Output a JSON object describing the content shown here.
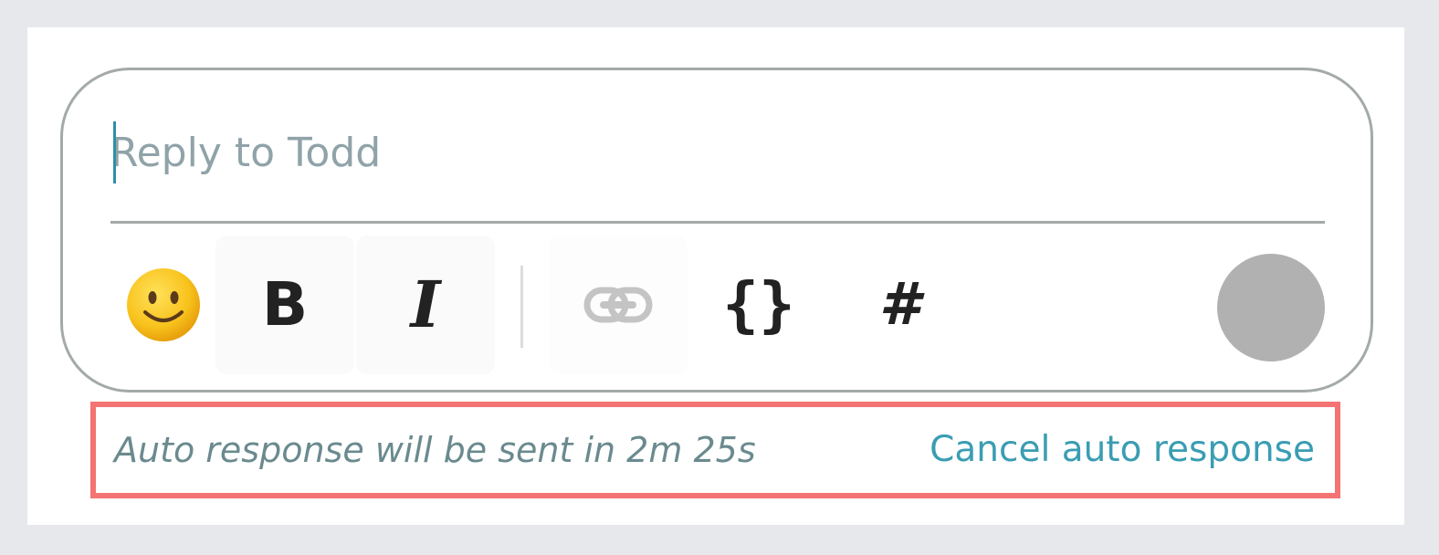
{
  "composer": {
    "placeholder": "Reply to Todd",
    "value": ""
  },
  "toolbar": {
    "emoji": {
      "icon": "smiling-face-emoji",
      "glyph": "🙂"
    },
    "bold": {
      "icon": "bold-icon",
      "glyph": "B"
    },
    "italic": {
      "icon": "italic-icon",
      "glyph": "I"
    },
    "link": {
      "icon": "link-icon"
    },
    "code": {
      "icon": "code-braces-icon",
      "glyph": "{}"
    },
    "channel": {
      "icon": "hash-icon",
      "glyph": "#"
    },
    "send": {
      "icon": "send-button-circle",
      "color": "#b1b1b1"
    }
  },
  "auto_response": {
    "status_text": "Auto response will be sent in 2m 25s",
    "cancel_label": "Cancel auto response",
    "highlight_color": "#f47373"
  },
  "colors": {
    "accent": "#3a9db3",
    "border": "#a3aaa9",
    "background": "#e6e8ec"
  }
}
